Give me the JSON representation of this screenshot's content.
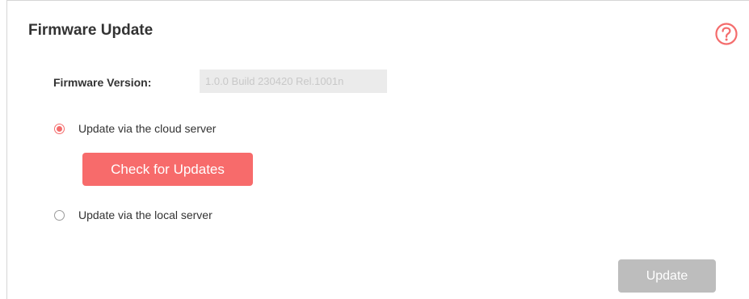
{
  "section": {
    "title": "Firmware Update"
  },
  "firmware": {
    "label": "Firmware Version:",
    "value": "1.0.0 Build 230420 Rel.1001n"
  },
  "options": {
    "cloud_label": "Update via the cloud server",
    "cloud_selected": true,
    "local_label": "Update via the local server",
    "local_selected": false
  },
  "buttons": {
    "check_label": "Check for Updates",
    "update_label": "Update"
  },
  "colors": {
    "accent": "#f76b6b",
    "disabled": "#bdbdbd",
    "field_bg": "#ebebeb"
  },
  "icons": {
    "help": "help-circle-icon"
  }
}
